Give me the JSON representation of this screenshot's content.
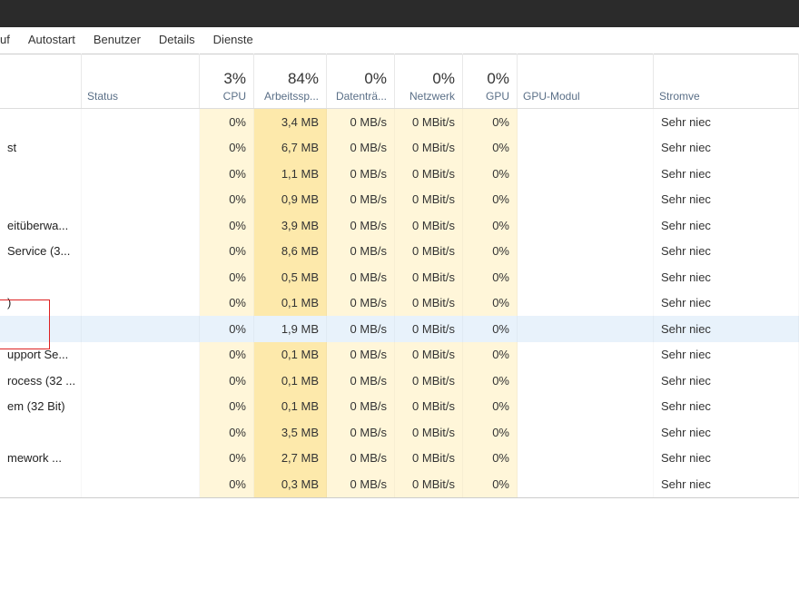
{
  "tabs": {
    "t0": "uf",
    "t1": "Autostart",
    "t2": "Benutzer",
    "t3": "Details",
    "t4": "Dienste"
  },
  "columns": {
    "status": "Status",
    "cpu_pct": "3%",
    "cpu_label": "CPU",
    "mem_pct": "84%",
    "mem_label": "Arbeitssp...",
    "disk_pct": "0%",
    "disk_label": "Datenträ...",
    "net_pct": "0%",
    "net_label": "Netzwerk",
    "gpu_pct": "0%",
    "gpu_label": "GPU",
    "gpumod_label": "GPU-Modul",
    "power_label": "Stromve"
  },
  "rows": [
    {
      "name": "",
      "cpu": "0%",
      "mem": "3,4 MB",
      "disk": "0 MB/s",
      "net": "0 MBit/s",
      "gpu": "0%",
      "power": "Sehr niec"
    },
    {
      "name": "st",
      "cpu": "0%",
      "mem": "6,7 MB",
      "disk": "0 MB/s",
      "net": "0 MBit/s",
      "gpu": "0%",
      "power": "Sehr niec"
    },
    {
      "name": "",
      "cpu": "0%",
      "mem": "1,1 MB",
      "disk": "0 MB/s",
      "net": "0 MBit/s",
      "gpu": "0%",
      "power": "Sehr niec"
    },
    {
      "name": "",
      "cpu": "0%",
      "mem": "0,9 MB",
      "disk": "0 MB/s",
      "net": "0 MBit/s",
      "gpu": "0%",
      "power": "Sehr niec"
    },
    {
      "name": "eitüberwa...",
      "cpu": "0%",
      "mem": "3,9 MB",
      "disk": "0 MB/s",
      "net": "0 MBit/s",
      "gpu": "0%",
      "power": "Sehr niec"
    },
    {
      "name": "Service (3...",
      "cpu": "0%",
      "mem": "8,6 MB",
      "disk": "0 MB/s",
      "net": "0 MBit/s",
      "gpu": "0%",
      "power": "Sehr niec"
    },
    {
      "name": "",
      "cpu": "0%",
      "mem": "0,5 MB",
      "disk": "0 MB/s",
      "net": "0 MBit/s",
      "gpu": "0%",
      "power": "Sehr niec"
    },
    {
      "name": ")",
      "cpu": "0%",
      "mem": "0,1 MB",
      "disk": "0 MB/s",
      "net": "0 MBit/s",
      "gpu": "0%",
      "power": "Sehr niec"
    },
    {
      "name": "",
      "cpu": "0%",
      "mem": "1,9 MB",
      "disk": "0 MB/s",
      "net": "0 MBit/s",
      "gpu": "0%",
      "power": "Sehr niec",
      "selected": true
    },
    {
      "name": "upport Se...",
      "cpu": "0%",
      "mem": "0,1 MB",
      "disk": "0 MB/s",
      "net": "0 MBit/s",
      "gpu": "0%",
      "power": "Sehr niec"
    },
    {
      "name": "rocess (32 ...",
      "cpu": "0%",
      "mem": "0,1 MB",
      "disk": "0 MB/s",
      "net": "0 MBit/s",
      "gpu": "0%",
      "power": "Sehr niec"
    },
    {
      "name": "em (32 Bit)",
      "cpu": "0%",
      "mem": "0,1 MB",
      "disk": "0 MB/s",
      "net": "0 MBit/s",
      "gpu": "0%",
      "power": "Sehr niec"
    },
    {
      "name": "",
      "cpu": "0%",
      "mem": "3,5 MB",
      "disk": "0 MB/s",
      "net": "0 MBit/s",
      "gpu": "0%",
      "power": "Sehr niec"
    },
    {
      "name": "mework ...",
      "cpu": "0%",
      "mem": "2,7 MB",
      "disk": "0 MB/s",
      "net": "0 MBit/s",
      "gpu": "0%",
      "power": "Sehr niec"
    },
    {
      "name": "",
      "cpu": "0%",
      "mem": "0,3 MB",
      "disk": "0 MB/s",
      "net": "0 MBit/s",
      "gpu": "0%",
      "power": "Sehr niec"
    }
  ]
}
